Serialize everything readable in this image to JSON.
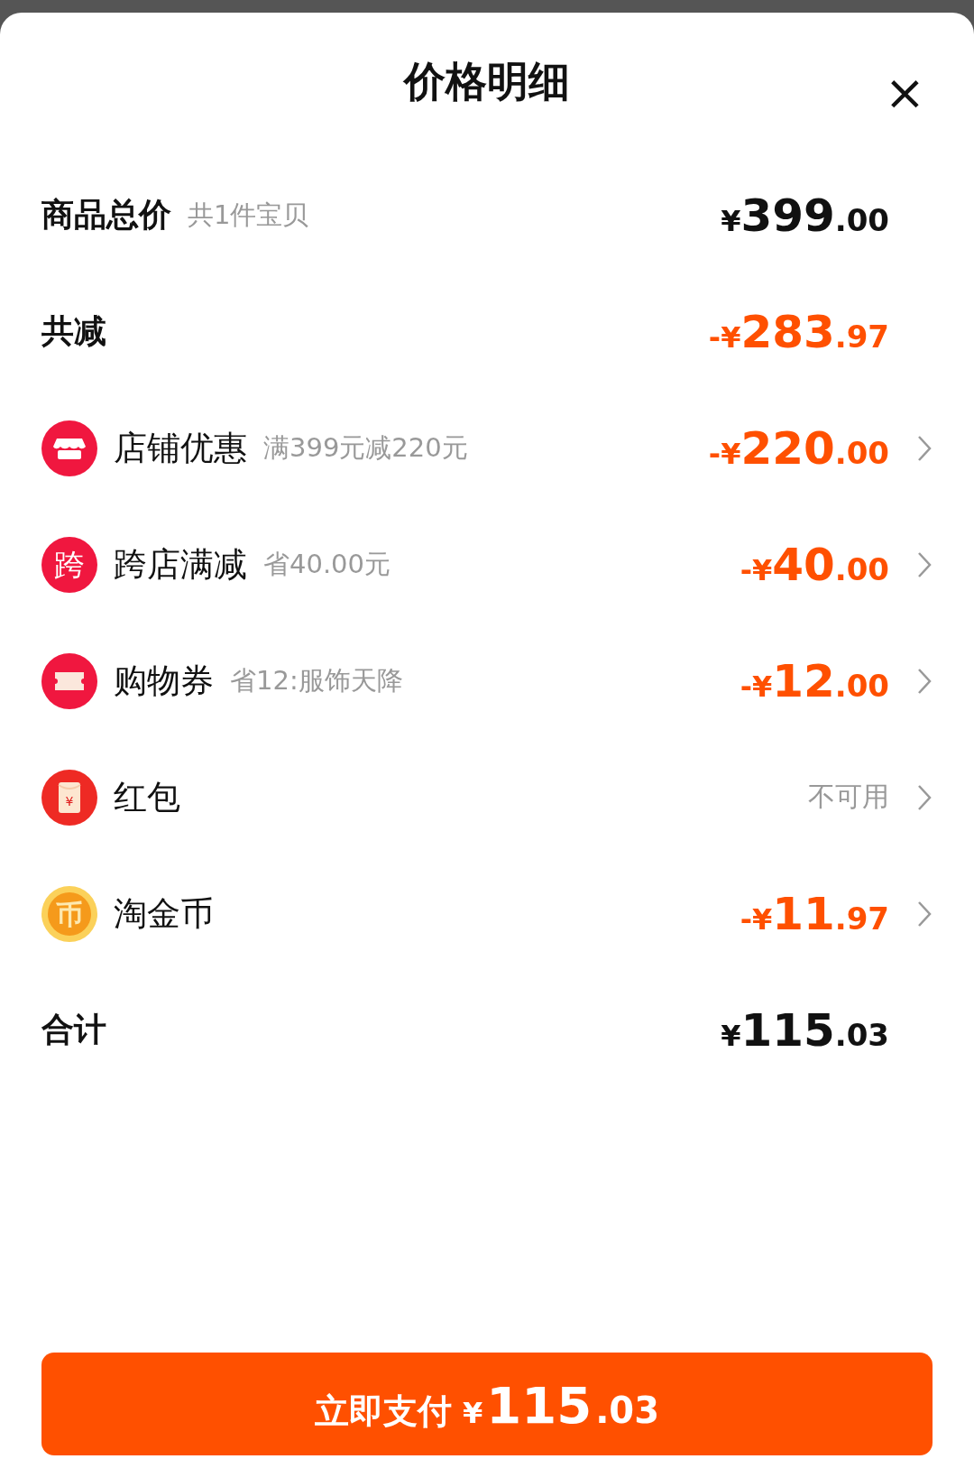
{
  "sheet": {
    "title": "价格明细",
    "close": "×"
  },
  "rows": [
    {
      "kind": "plain",
      "label": "商品总价",
      "note": "共1件宝贝",
      "amount": {
        "currency": "¥",
        "whole": "399",
        "cents": ".00",
        "highlight": false
      }
    },
    {
      "kind": "plain",
      "label": "共减",
      "amount": {
        "currency": "-¥",
        "whole": "283",
        "cents": ".97",
        "highlight": true
      }
    },
    {
      "kind": "shop",
      "label": "店铺优惠",
      "note": "满399元减220元",
      "amount": {
        "currency": "-¥",
        "whole": "220",
        "cents": ".00",
        "highlight": true
      }
    },
    {
      "kind": "cross",
      "badge": "跨",
      "label": "跨店满减",
      "note": "省40.00元",
      "amount": {
        "currency": "-¥",
        "whole": "40",
        "cents": ".00",
        "highlight": true
      }
    },
    {
      "kind": "ticket",
      "label": "购物券",
      "note": "省12:服饰天降",
      "amount": {
        "currency": "-¥",
        "whole": "12",
        "cents": ".00",
        "highlight": true
      }
    },
    {
      "kind": "envelope",
      "badge": "¥",
      "label": "红包",
      "status": "不可用"
    },
    {
      "kind": "coin",
      "badge": "币",
      "label": "淘金币",
      "amount": {
        "currency": "-¥",
        "whole": "11",
        "cents": ".97",
        "highlight": true
      }
    },
    {
      "kind": "plain",
      "label": "合计",
      "amount": {
        "currency": "¥",
        "whole": "115",
        "cents": ".03",
        "highlight": false
      }
    }
  ],
  "pay_button": {
    "label": "立即支付",
    "amount": {
      "currency": "¥",
      "whole": "115",
      "cents": ".03"
    }
  }
}
